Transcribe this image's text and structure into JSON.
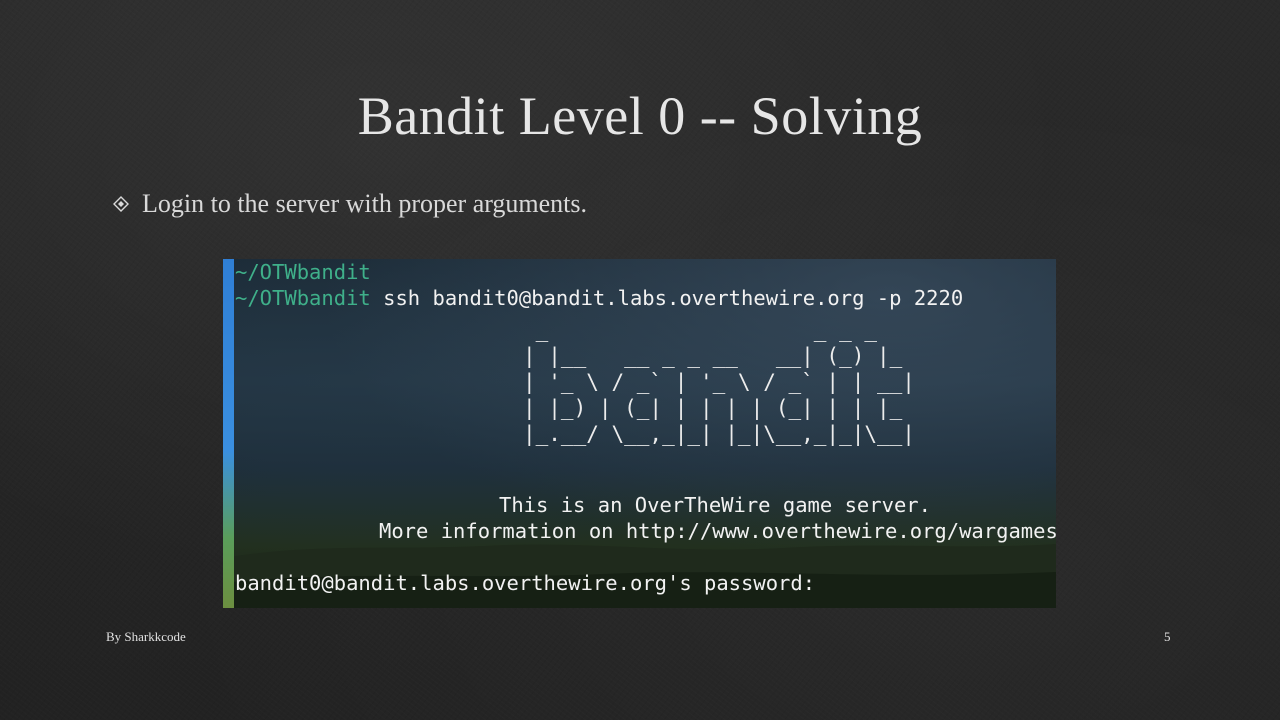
{
  "slide": {
    "title": "Bandit Level 0 -- Solving",
    "bullets": [
      {
        "icon": "diamond-bullet-icon",
        "text": "Login to the server with proper arguments."
      }
    ],
    "footer": {
      "author": "By Sharkkcode",
      "page_number": "5"
    }
  },
  "terminal": {
    "line1": {
      "prompt": "~/OTWbandit",
      "command": ""
    },
    "line2": {
      "prompt": "~/OTWbandit",
      "command": " ssh bandit0@bandit.labs.overthewire.org -p 2220"
    },
    "banner_ascii": " _                     _ _ _\n| |__   __ _ _ __   __| (_) |_\n| '_ \\ / _` | '_ \\ / _` | | __|\n| |_) | (_| | | | | (_| | | |_\n|_.__/ \\__,_|_| |_|\\__,_|_|\\__|",
    "banner_word": "bandit",
    "motd_line1": "This is an OverTheWire game server.",
    "motd_line2": "More information on http://www.overthewire.org/wargames",
    "password_prompt": "bandit0@bandit.labs.overthewire.org's password:"
  },
  "colors": {
    "prompt": "#3fb08a",
    "terminal_text": "#f2f2f2",
    "slide_background": "#262626",
    "title_text": "#e6e6e6"
  }
}
